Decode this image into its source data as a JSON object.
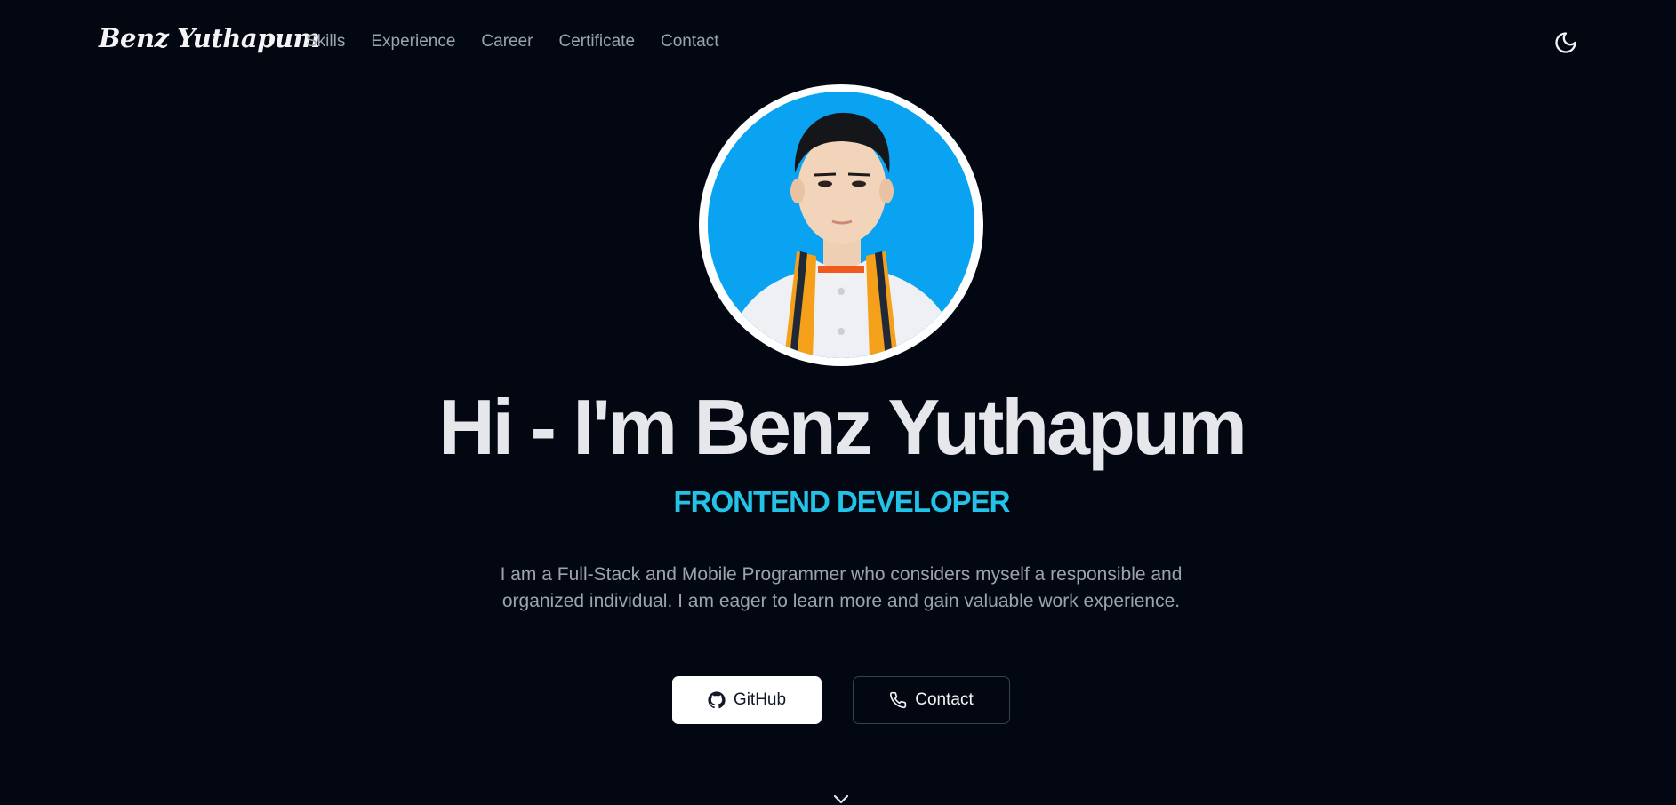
{
  "header": {
    "brand": "Benz Yuthapum",
    "nav": [
      {
        "label": "Skills"
      },
      {
        "label": "Experience"
      },
      {
        "label": "Career"
      },
      {
        "label": "Certificate"
      },
      {
        "label": "Contact"
      }
    ],
    "theme_toggle_icon": "moon-icon"
  },
  "hero": {
    "avatar_icon": "profile-photo",
    "title": "Hi - I'm Benz Yuthapum",
    "role": "FRONTEND DEVELOPER",
    "description": "I am a Full-Stack and Mobile Programmer who considers myself a responsible and organized individual. I am eager to learn more and gain valuable work experience.",
    "buttons": {
      "github": {
        "label": "GitHub",
        "icon": "github-icon"
      },
      "contact": {
        "label": "Contact",
        "icon": "phone-icon"
      }
    },
    "scroll_icon": "chevron-down-icon"
  },
  "colors": {
    "background": "#030712",
    "accent": "#22c3e6",
    "title": "#e5e7eb",
    "muted": "#9ca3af"
  }
}
